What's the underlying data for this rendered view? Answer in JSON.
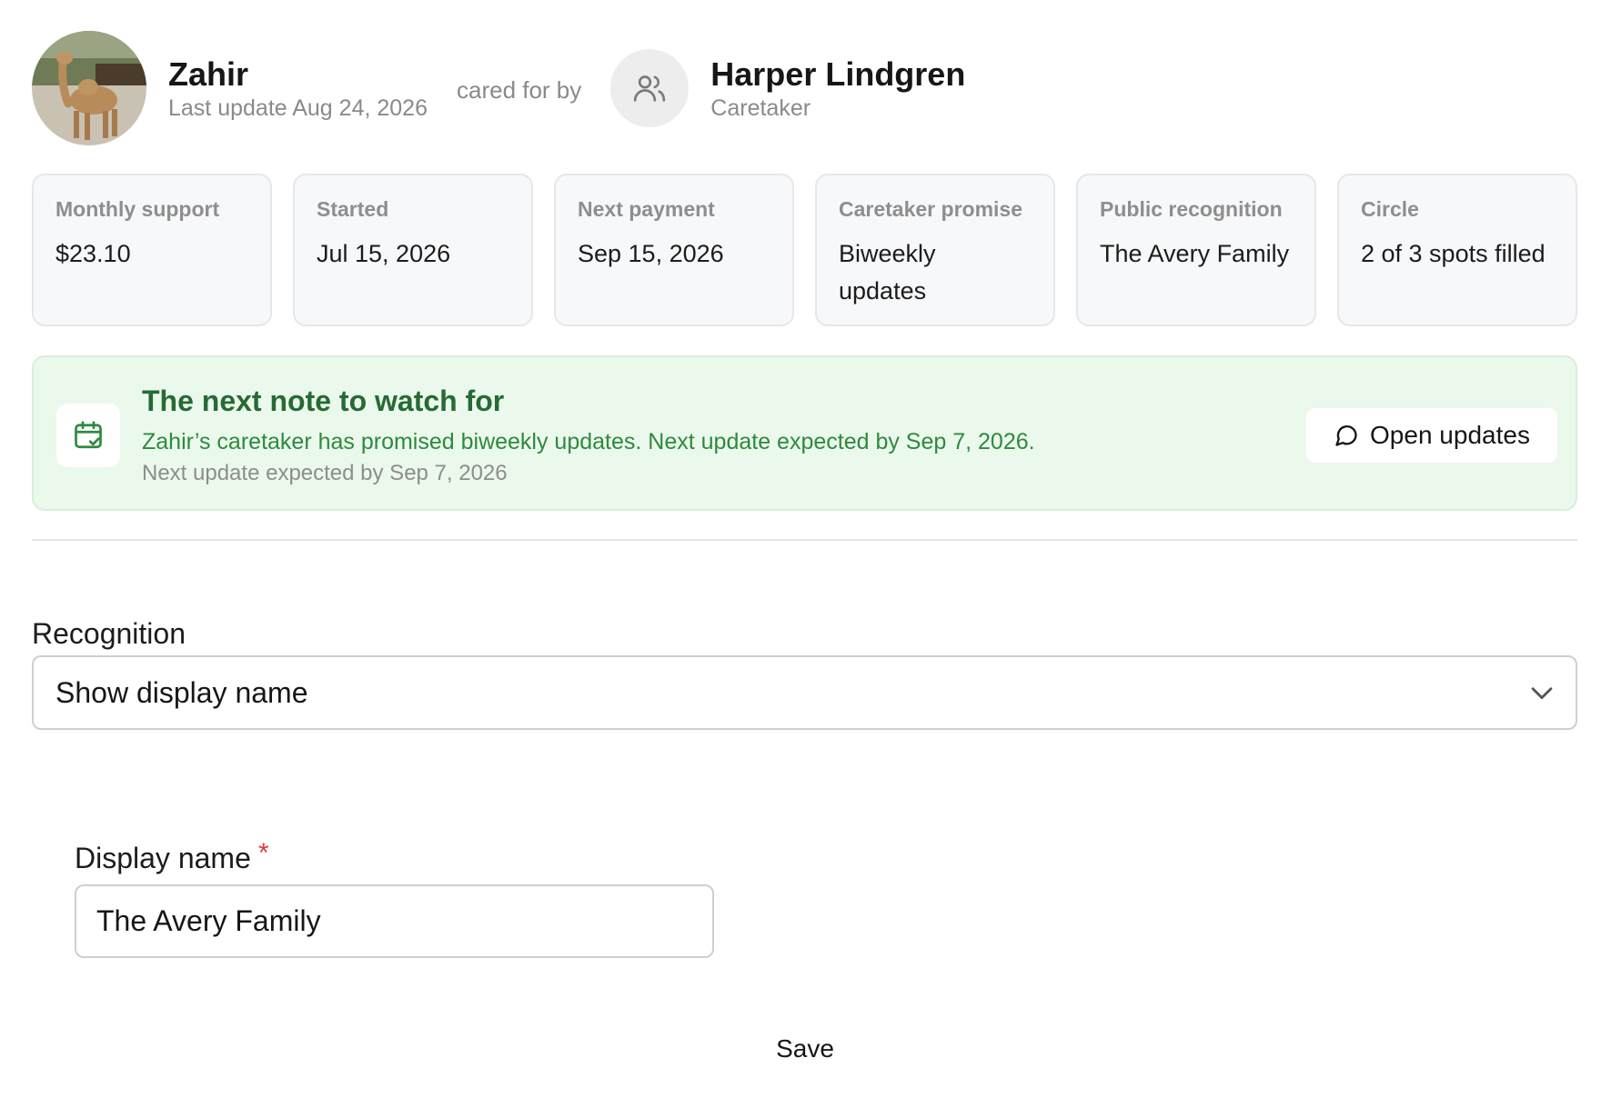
{
  "animal": {
    "name": "Zahir",
    "last_update": "Last update Aug 24, 2026",
    "photo_icon": "camel-photo"
  },
  "cared_by_label": "cared for by",
  "caretaker": {
    "name": "Harper Lindgren",
    "role": "Caretaker",
    "avatar_icon": "users-icon"
  },
  "stats": [
    {
      "label": "Monthly support",
      "value": "$23.10"
    },
    {
      "label": "Started",
      "value": "Jul 15, 2026"
    },
    {
      "label": "Next payment",
      "value": "Sep 15, 2026"
    },
    {
      "label": "Caretaker promise",
      "value": "Biweekly updates"
    },
    {
      "label": "Public recognition",
      "value": "The Avery Family"
    },
    {
      "label": "Circle",
      "value": "2 of 3 spots filled"
    }
  ],
  "banner": {
    "icon": "calendar-check-icon",
    "title": "The next note to watch for",
    "text": "Zahir’s caretaker has promised biweekly updates. Next update expected by Sep 7, 2026.",
    "subtext": "Next update expected by Sep 7, 2026",
    "button_label": "Open updates",
    "button_icon": "message-circle-icon"
  },
  "recognition": {
    "label": "Recognition",
    "selected": "Show display name"
  },
  "display_name": {
    "label": "Display name",
    "required_mark": "*",
    "value": "The Avery Family"
  },
  "save_label": "Save",
  "colors": {
    "banner_bg": "#ebf8ec",
    "banner_title": "#256b34",
    "banner_text": "#2d8a3e",
    "required": "#e53935"
  }
}
